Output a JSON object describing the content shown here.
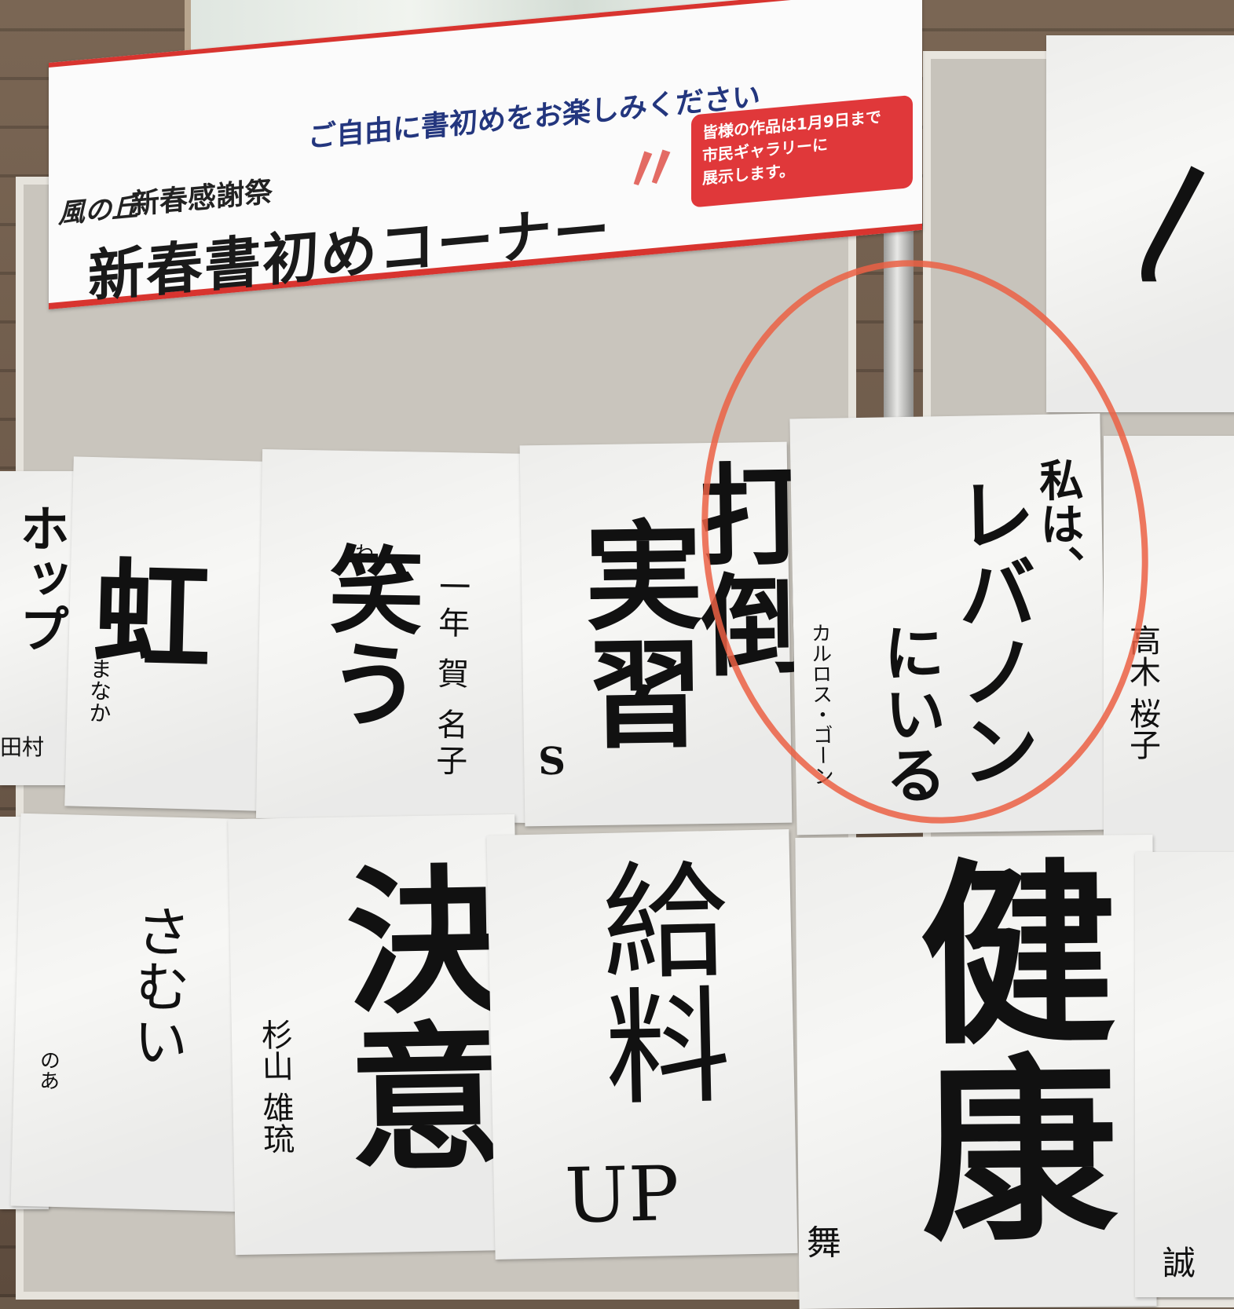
{
  "banner": {
    "logo": "風の丘",
    "event": "新春感謝祭",
    "slogan": "ご自由に書初めをお楽しみください",
    "title": "新春書初めコーナー",
    "notice_line1": "皆様の作品は1月9日まで",
    "notice_line2": "市民ギャラリーに",
    "notice_line3": "展示します。"
  },
  "papers": {
    "p_left_top": {
      "text": "ホップ",
      "name": "田村"
    },
    "p_mushi": {
      "text": "虹",
      "name": "まなか"
    },
    "p_warau": {
      "text": "笑う",
      "furigana": "わ",
      "name": "一年 賀 名子"
    },
    "p_jisshu": {
      "text": "実習",
      "mark": "S"
    },
    "p_datou": {
      "text": "打倒"
    },
    "p_lebanon": {
      "text_line1": "私は、",
      "text_line2": "レバノン",
      "text_line3": "にいる",
      "name": "カルロス・ゴーン"
    },
    "p_takagi": {
      "name": "高木 桜子"
    },
    "p_samui": {
      "text": "さむい",
      "name": "のあ"
    },
    "p_ketsui": {
      "text": "決意",
      "name": "杉山 雄琉"
    },
    "p_kyuyo": {
      "text": "給料",
      "sub": "UP"
    },
    "p_kenkou": {
      "text": "健康",
      "name": "舞"
    },
    "p_right_bottom": {
      "name": "誠"
    }
  }
}
